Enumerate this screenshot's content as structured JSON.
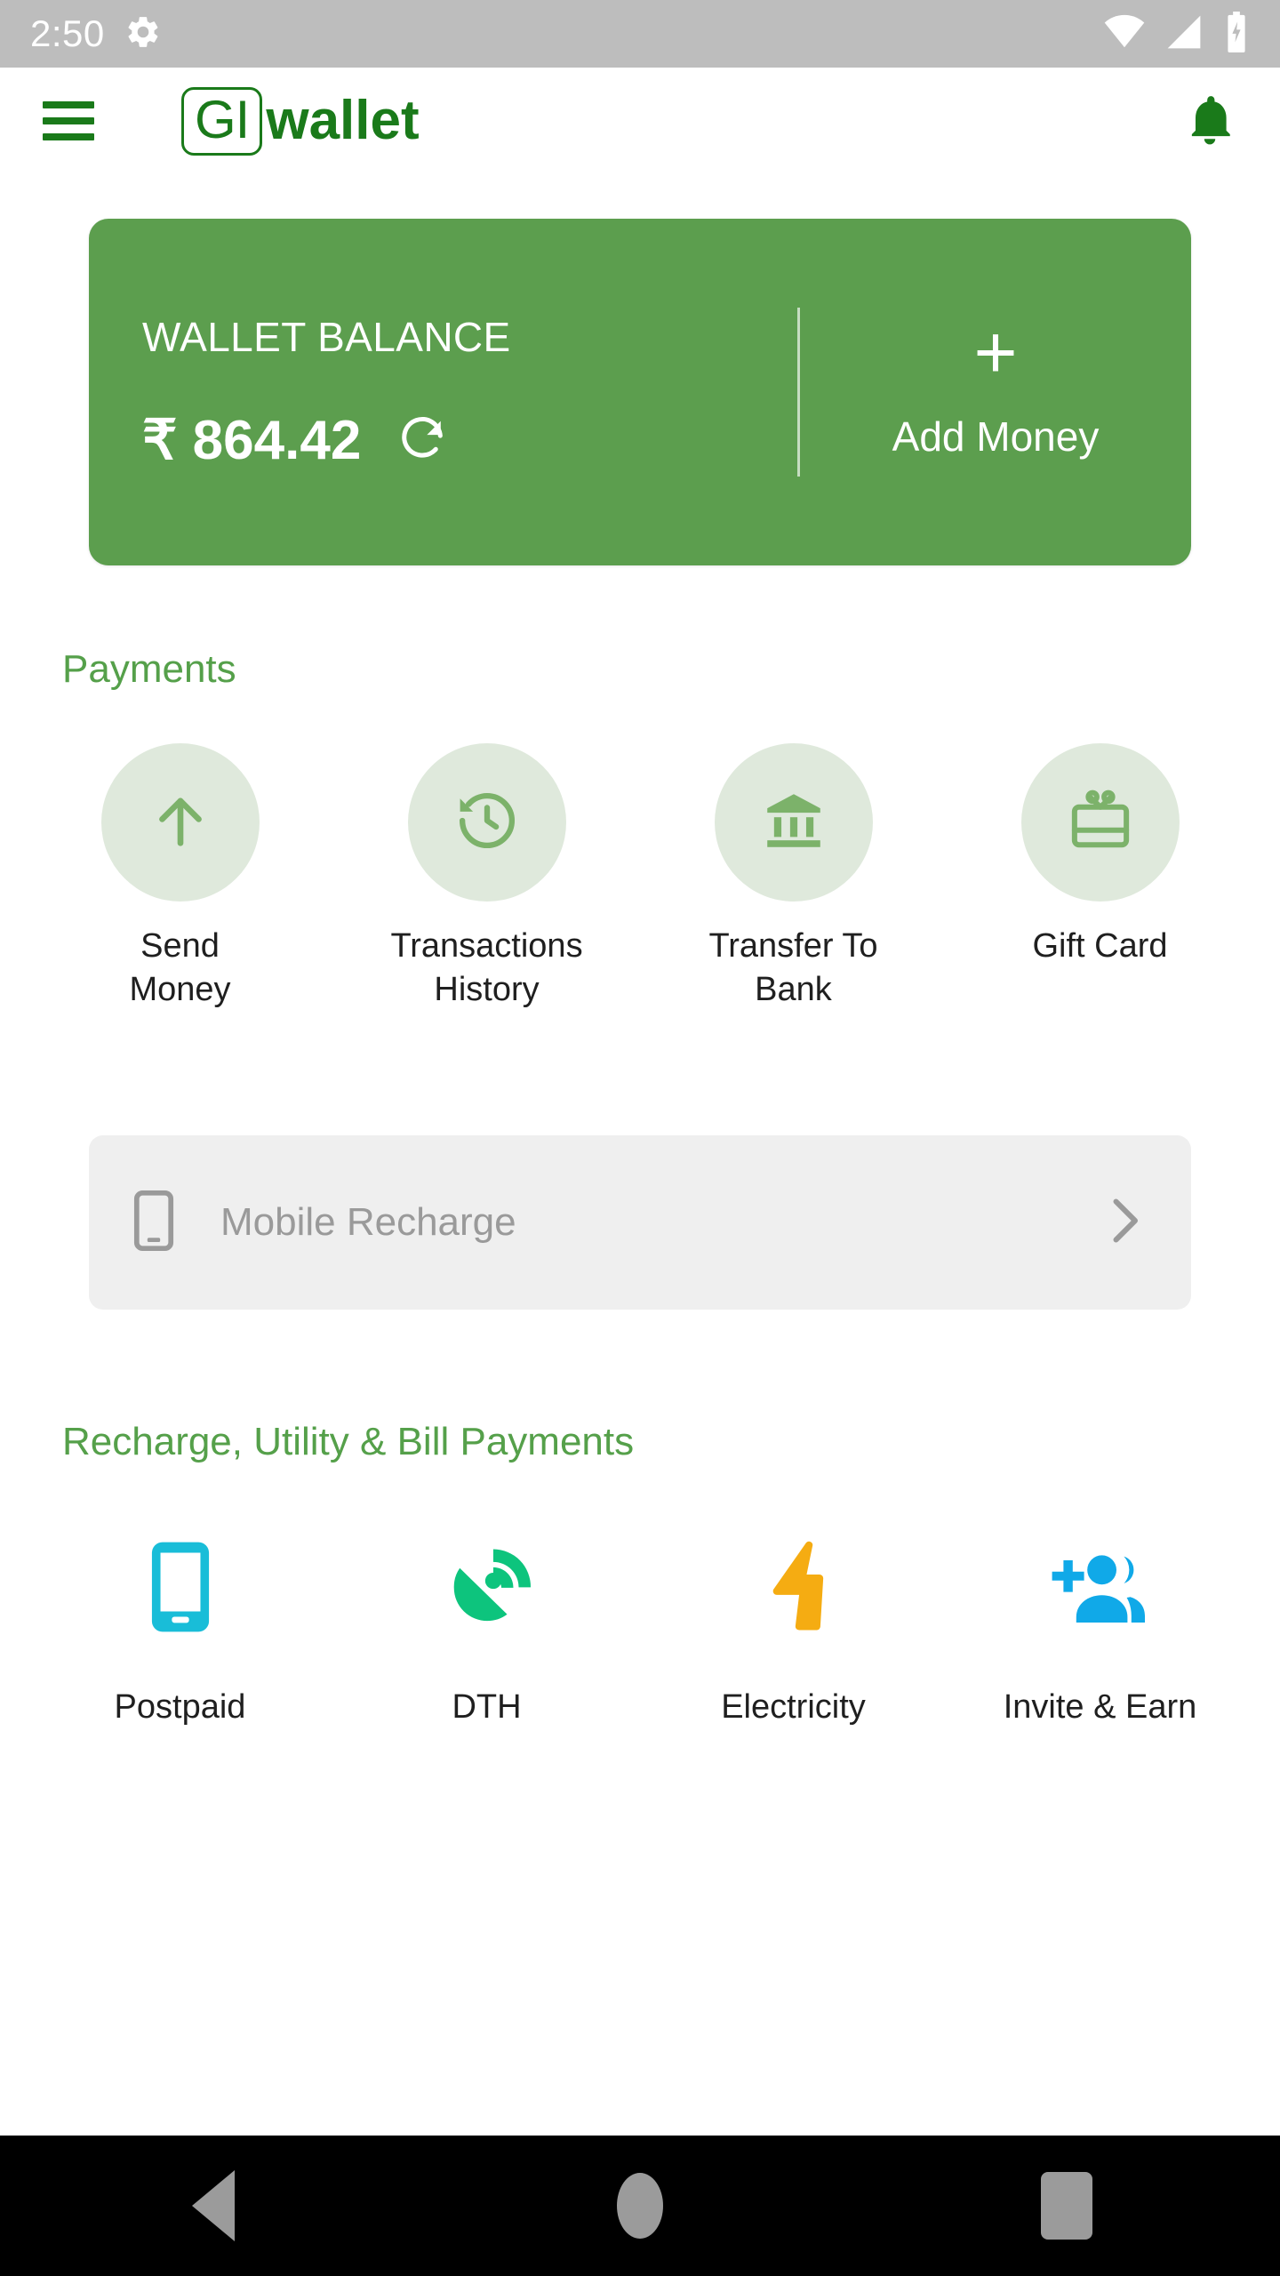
{
  "status_bar": {
    "time": "2:50",
    "settings_icon": "gear-icon",
    "wifi_icon": "wifi-icon",
    "signal_icon": "cellular-signal-icon",
    "battery_icon": "battery-charging-icon",
    "background": "#bdbdbd"
  },
  "app_bar": {
    "menu_icon": "hamburger-menu-icon",
    "logo_mark": "GI",
    "logo_word": "wallet",
    "notification_icon": "bell-icon",
    "brand_color": "#1a7a1a"
  },
  "balance_card": {
    "title": "WALLET BALANCE",
    "amount": "₹ 864.42",
    "refresh_icon": "refresh-icon",
    "add_plus": "+",
    "add_label": "Add Money",
    "card_color": "#5c9e4e"
  },
  "payments": {
    "heading": "Payments",
    "heading_color": "#55a04a",
    "circle_color": "#dfe9dc",
    "items": [
      {
        "label": "Send\nMoney",
        "line1": "Send",
        "line2": "Money",
        "icon": "arrow-up-icon"
      },
      {
        "label": "Transactions\nHistory",
        "line1": "Transactions",
        "line2": "History",
        "icon": "history-clock-icon"
      },
      {
        "label": "Transfer To\nBank",
        "line1": "Transfer To",
        "line2": "Bank",
        "icon": "bank-icon"
      },
      {
        "label": "Gift Card",
        "line1": "Gift Card",
        "line2": "",
        "icon": "gift-card-icon"
      }
    ]
  },
  "mobile_recharge": {
    "phone_icon": "smartphone-icon",
    "placeholder": "Mobile Recharge",
    "chevron_icon": "chevron-right-icon",
    "background": "#efefef"
  },
  "bill_payments": {
    "heading": "Recharge, Utility & Bill Payments",
    "heading_color": "#55a04a",
    "items": [
      {
        "label": "Postpaid",
        "icon": "smartphone-filled-icon",
        "color": "#19bdd8"
      },
      {
        "label": "DTH",
        "icon": "satellite-dish-icon",
        "color": "#0dc47d"
      },
      {
        "label": "Electricity",
        "icon": "lightning-bolt-icon",
        "color": "#f5ac12"
      },
      {
        "label": "Invite & Earn",
        "icon": "add-people-icon",
        "color": "#10a9e8"
      }
    ]
  },
  "nav_bar": {
    "back_icon": "back-triangle-icon",
    "home_icon": "home-circle-icon",
    "recents_icon": "recents-square-icon",
    "background": "#000000"
  }
}
